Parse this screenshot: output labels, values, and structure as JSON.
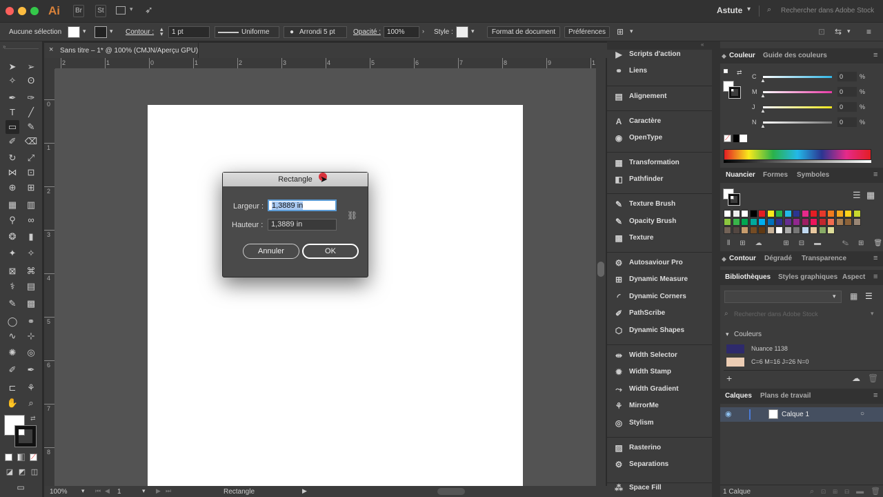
{
  "app": {
    "logo": "Ai",
    "bridge": "Br",
    "stock": "St",
    "workspace": "Astute",
    "search_placeholder": "Rechercher dans Adobe Stock"
  },
  "control": {
    "selection": "Aucune sélection",
    "contour_label": "Contour :",
    "stroke_weight": "1 pt",
    "stroke_profile": "Uniforme",
    "brush": "Arrondi 5 pt",
    "opacity_label": "Opacité :",
    "opacity": "100%",
    "style_label": "Style :",
    "doc_format": "Format de document",
    "prefs": "Préférences"
  },
  "document": {
    "tab_title": "Sans titre – 1* @ 100% (CMJN/Aperçu GPU)",
    "close": "×"
  },
  "ruler": {
    "h": [
      "2",
      "1",
      "0",
      "1",
      "2",
      "3",
      "4",
      "5",
      "6",
      "7",
      "8",
      "9",
      "1"
    ],
    "v": [
      "0",
      "1",
      "2",
      "3",
      "4",
      "5",
      "6",
      "7",
      "8"
    ]
  },
  "status": {
    "zoom": "100%",
    "page": "1",
    "tool": "Rectangle"
  },
  "dialog": {
    "title": "Rectangle",
    "width_label": "Largeur :",
    "width_value": "1,3889 in",
    "height_label": "Hauteur :",
    "height_value": "1,3889 in",
    "cancel": "Annuler",
    "ok": "OK"
  },
  "mid_panel": {
    "items": [
      {
        "label": "Scripts d'action",
        "icon": "play-icon"
      },
      {
        "label": "Liens",
        "icon": "link-icon"
      },
      {
        "label": "Alignement",
        "icon": "align-icon"
      },
      {
        "label": "Caractère",
        "icon": "character-icon"
      },
      {
        "label": "OpenType",
        "icon": "opentype-icon"
      },
      {
        "label": "Transformation",
        "icon": "transform-icon"
      },
      {
        "label": "Pathfinder",
        "icon": "pathfinder-icon"
      },
      {
        "label": "Texture Brush",
        "icon": "brush-icon"
      },
      {
        "label": "Opacity Brush",
        "icon": "brush-icon"
      },
      {
        "label": "Texture",
        "icon": "texture-icon"
      },
      {
        "label": "Autosaviour Pro",
        "icon": "autosave-icon"
      },
      {
        "label": "Dynamic Measure",
        "icon": "measure-icon"
      },
      {
        "label": "Dynamic Corners",
        "icon": "corners-icon"
      },
      {
        "label": "PathScribe",
        "icon": "pathscribe-icon"
      },
      {
        "label": "Dynamic Shapes",
        "icon": "shapes-icon"
      },
      {
        "label": "Width Selector",
        "icon": "width-selector-icon"
      },
      {
        "label": "Width Stamp",
        "icon": "width-stamp-icon"
      },
      {
        "label": "Width Gradient",
        "icon": "width-gradient-icon"
      },
      {
        "label": "MirrorMe",
        "icon": "mirror-icon"
      },
      {
        "label": "Stylism",
        "icon": "stylism-icon"
      },
      {
        "label": "Rasterino",
        "icon": "raster-icon"
      },
      {
        "label": "Separations",
        "icon": "separations-icon"
      },
      {
        "label": "Space Fill",
        "icon": "spacefill-icon"
      }
    ]
  },
  "color_panel": {
    "tab1": "Couleur",
    "tab2": "Guide des couleurs",
    "channels": [
      {
        "name": "C",
        "value": "0",
        "unit": "%",
        "color": "#33b8e8"
      },
      {
        "name": "M",
        "value": "0",
        "unit": "%",
        "color": "#e83aa6"
      },
      {
        "name": "J",
        "value": "0",
        "unit": "%",
        "color": "#f0e61e"
      },
      {
        "name": "N",
        "value": "0",
        "unit": "%",
        "color": "#777777"
      }
    ]
  },
  "swatch_panel": {
    "tab1": "Nuancier",
    "tab2": "Formes",
    "tab3": "Symboles"
  },
  "stroke_panel": {
    "tab1": "Contour",
    "tab2": "Dégradé",
    "tab3": "Transparence"
  },
  "libraries": {
    "tab1": "Bibliothèques",
    "tab2": "Styles graphiques",
    "tab3": "Aspect",
    "search_placeholder": "Rechercher dans Adobe Stock",
    "group": "Couleurs",
    "colors": [
      {
        "name": "Nuance 1138",
        "hex": "#2e2a6b"
      },
      {
        "name": "C=6 M=16 J=26 N=0",
        "hex": "#eccdb4"
      }
    ]
  },
  "layers": {
    "tab1": "Calques",
    "tab2": "Plans de travail",
    "layer_name": "Calque 1",
    "count": "1 Calque"
  }
}
